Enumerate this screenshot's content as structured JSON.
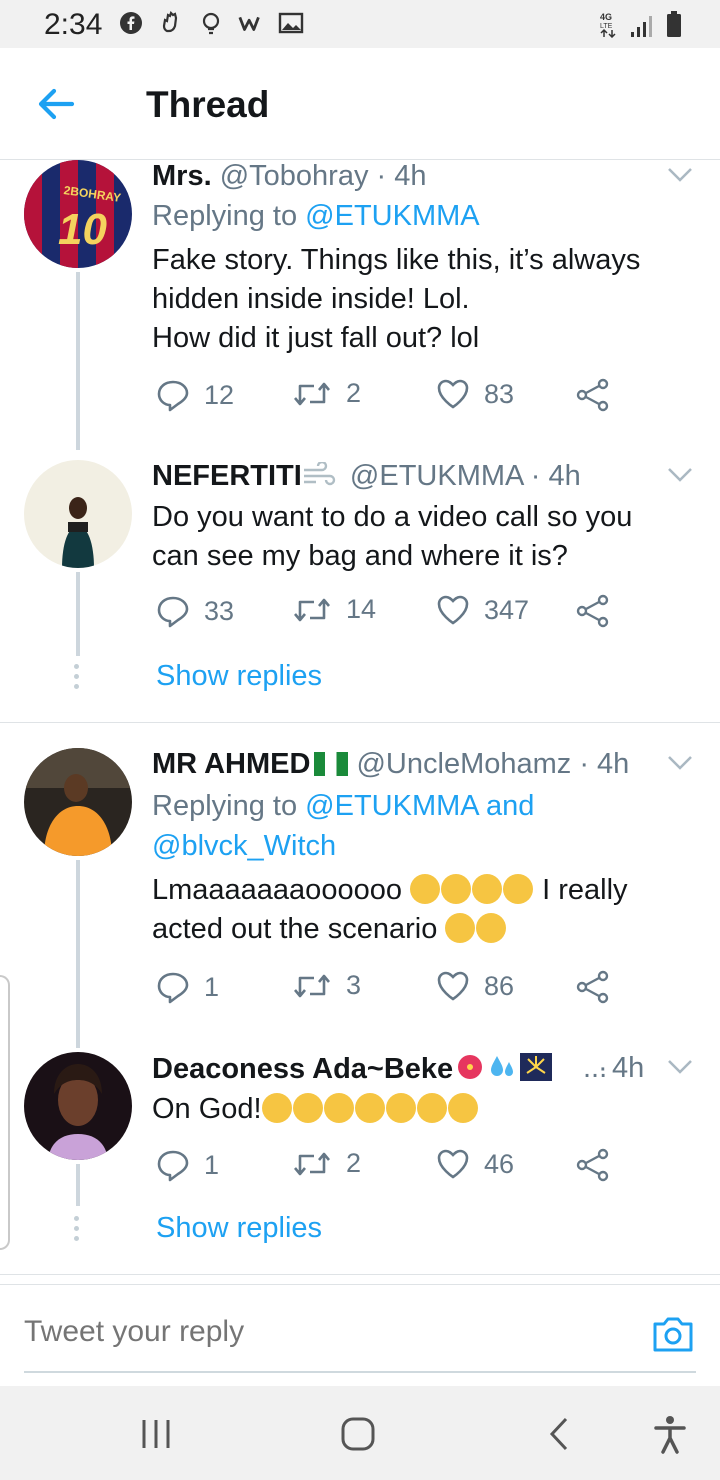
{
  "status_bar": {
    "time": "2:34"
  },
  "header": {
    "title": "Thread"
  },
  "tweets": [
    {
      "name": "Mrs.",
      "handle": "@Tobohray",
      "time": "4h",
      "replying_prefix": "Replying to ",
      "replying_to": "@ETUKMMA",
      "lines": [
        "Fake story. Things like this, it’s always",
        "hidden inside inside! Lol.",
        "How did it just fall out? lol"
      ],
      "replies": "12",
      "retweets": "2",
      "likes": "83"
    },
    {
      "name": "NEFERTITI",
      "handle": "@ETUKMMA",
      "time": "4h",
      "lines": [
        "Do you want to do a video call so you",
        "can see my bag and where it is?"
      ],
      "replies": "33",
      "retweets": "14",
      "likes": "347",
      "show_replies": "Show replies"
    },
    {
      "name": "MR AHMED",
      "handle": "@UncleMohamz",
      "time": "4h",
      "replying_prefix": "Replying to ",
      "replying_to": "@ETUKMMA and",
      "replying_to_2": "@blvck_Witch",
      "line1": "Lmaaaaaaaoooooo",
      "line1_end": "I really",
      "line2": "acted out the scenario",
      "replies": "1",
      "retweets": "3",
      "likes": "86"
    },
    {
      "name": "Deaconess Ada~Beke",
      "ellipsis": "...",
      "time": "4h",
      "line1": "On God!",
      "replies": "1",
      "retweets": "2",
      "likes": "46",
      "show_replies": "Show replies"
    }
  ],
  "reply_bar": {
    "placeholder": "Tweet your reply"
  },
  "colors": {
    "accent": "#1da1f2",
    "muted": "#657786",
    "text": "#14171a"
  }
}
